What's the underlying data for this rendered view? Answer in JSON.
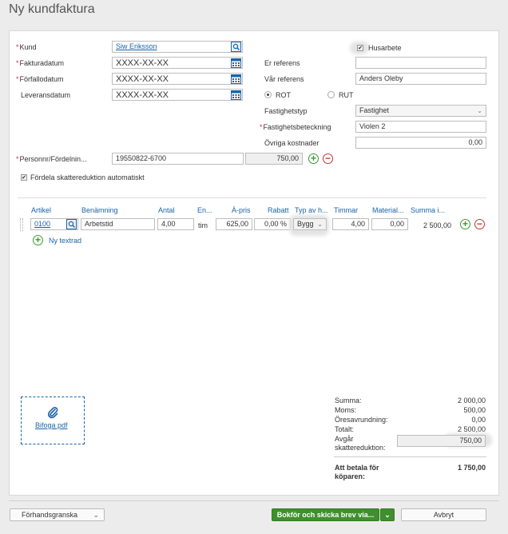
{
  "page_title": "Ny kundfaktura",
  "left_form": {
    "kund_label": "Kund",
    "kund_value": "Siw Eriksson",
    "fakturadatum_label": "Fakturadatum",
    "fakturadatum_value": "XXXX-XX-XX",
    "forfallodatum_label": "Förfallodatum",
    "forfallodatum_value": "XXXX-XX-XX",
    "leveransdatum_label": "Leveransdatum",
    "leveransdatum_value": "XXXX-XX-XX",
    "personnr_label": "Personnr/Fördelnin...",
    "personnr_value": "19550822-6700",
    "personnr_amount": "750,00",
    "fordela_label": "Fördela skattereduktion automatiskt"
  },
  "right_form": {
    "husarbete_label": "Husarbete",
    "er_referens_label": "Er referens",
    "er_referens_value": "",
    "var_referens_label": "Vår referens",
    "var_referens_value": "Anders Oleby",
    "rot_label": "ROT",
    "rut_label": "RUT",
    "fastighetstyp_label": "Fastighetstyp",
    "fastighetstyp_value": "Fastighet",
    "fastighetsbeteckning_label": "Fastighetsbeteckning",
    "fastighetsbeteckning_value": "Violen 2",
    "ovriga_label": "Övriga kostnader",
    "ovriga_value": "0,00"
  },
  "table": {
    "headers": [
      "Artikel",
      "Benämning",
      "Antal",
      "En...",
      "À-pris",
      "Rabatt",
      "Typ av h...",
      "Timmar",
      "Material...",
      "Summa i..."
    ],
    "row": {
      "artikel": "0100",
      "benamning": "Arbetstid",
      "antal": "4,00",
      "enhet": "tim",
      "apris": "625,00",
      "rabatt": "0,00 %",
      "typ": "Bygg",
      "timmar": "4,00",
      "material": "0,00",
      "summa": "2 500,00"
    },
    "ny_textrad": "Ny textrad"
  },
  "attach": {
    "label": "Bifoga pdf"
  },
  "summary": {
    "summa_label": "Summa:",
    "summa_value": "2 000,00",
    "moms_label": "Moms:",
    "moms_value": "500,00",
    "ores_label": "Öresavrundning:",
    "ores_value": "0,00",
    "totalt_label": "Totalt:",
    "totalt_value": "2 500,00",
    "avgar_label1": "Avgår",
    "avgar_label2": "skattereduktion:",
    "avgar_value": "750,00",
    "att_betala_label1": "Att betala för",
    "att_betala_label2": "köparen:",
    "att_betala_value": "1 750,00"
  },
  "footer": {
    "preview_label": "Förhandsgranska",
    "book_label": "Bokför och skicka brev via...",
    "cancel_label": "Avbryt"
  },
  "colors": {
    "accent_blue": "#1a63a8",
    "green": "#3f8f2e",
    "required": "#c0392b"
  }
}
